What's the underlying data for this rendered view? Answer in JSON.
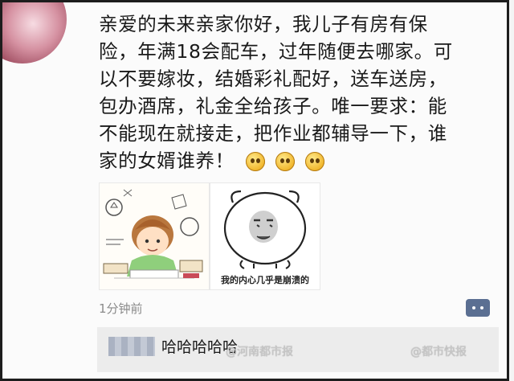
{
  "post": {
    "lines": [
      "亲爱的未来亲家你好，我儿子有房有保",
      "险，年满18会配车，过年随便去哪家。可",
      "以不要嫁妆，结婚彩礼配好，送车送房，",
      "包办酒席，礼金全给孩子。唯一要求：能",
      "不能现在就接走，把作业都辅导一下，谁",
      "家的女婿谁养！"
    ],
    "emojis": [
      "sweat-smile-emoji",
      "sweat-smile-emoji",
      "sweat-smile-emoji"
    ],
    "timestamp": "1分钟前"
  },
  "images": [
    {
      "name": "cartoon-child-with-books-image"
    },
    {
      "name": "panda-meme-image",
      "caption": "我的内心几乎是崩溃的"
    }
  ],
  "comment": {
    "text": "哈哈哈哈哈"
  },
  "watermarks": [
    "@河南都市报",
    "@都市快报"
  ],
  "icons": {
    "comment": "comment-bubble-icon"
  },
  "colors": {
    "comment_button": "#5b6f92",
    "timestamp": "#8a8a8a",
    "comment_bg": "#ececec"
  }
}
